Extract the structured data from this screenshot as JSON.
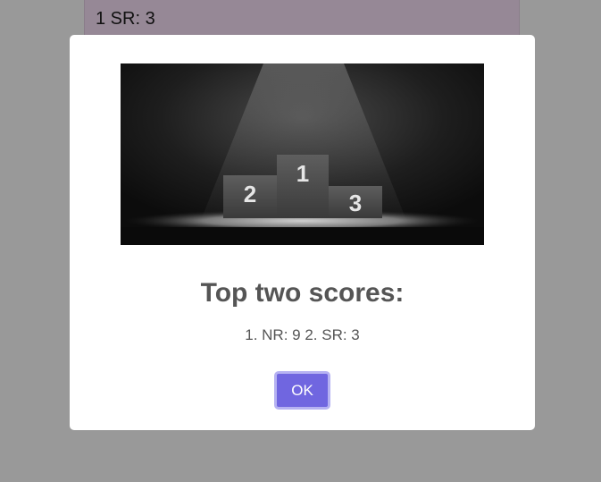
{
  "background": {
    "card_text": "1 SR: 3"
  },
  "modal": {
    "image_icon": "podium-icon",
    "title": "Top two scores:",
    "text": "1. NR: 9 2. SR: 3",
    "ok_label": "OK",
    "podium_numbers": [
      "2",
      "1",
      "3"
    ]
  },
  "colors": {
    "overlay": "#999999",
    "card_bg": "#968896",
    "confirm_button": "#7066e0",
    "confirm_focus_ring": "#b6b2f2",
    "text": "#555555"
  }
}
